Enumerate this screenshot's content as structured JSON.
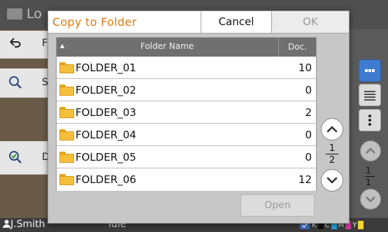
{
  "background": {
    "title": "Lo",
    "left_buttons": [
      {
        "label": "F",
        "icon": "back-arrow-icon"
      },
      {
        "label": "S",
        "icon": "search-icon"
      },
      {
        "label": "D",
        "icon": "check-search-icon"
      }
    ],
    "page_num": "1",
    "page_total": "1",
    "user": "J.Smith",
    "status_mid": "Idle",
    "ink_labels": [
      "K",
      "C",
      "M",
      "Y"
    ],
    "ink_colors": [
      "#111111",
      "#2aa7e0",
      "#d63d9c",
      "#f2d531"
    ]
  },
  "dialog": {
    "title": "Copy to Folder",
    "cancel_label": "Cancel",
    "ok_label": "OK",
    "col_name": "Folder Name",
    "col_doc": "Doc.",
    "sort_indicator": "▲",
    "folders": [
      {
        "name": "FOLDER_01",
        "docs": "10"
      },
      {
        "name": "FOLDER_02",
        "docs": "0"
      },
      {
        "name": "FOLDER_03",
        "docs": "2"
      },
      {
        "name": "FOLDER_04",
        "docs": "0"
      },
      {
        "name": "FOLDER_05",
        "docs": "0"
      },
      {
        "name": "FOLDER_06",
        "docs": "12"
      }
    ],
    "page_num": "1",
    "page_total": "2",
    "open_label": "Open",
    "accent_color": "#e07a10"
  }
}
